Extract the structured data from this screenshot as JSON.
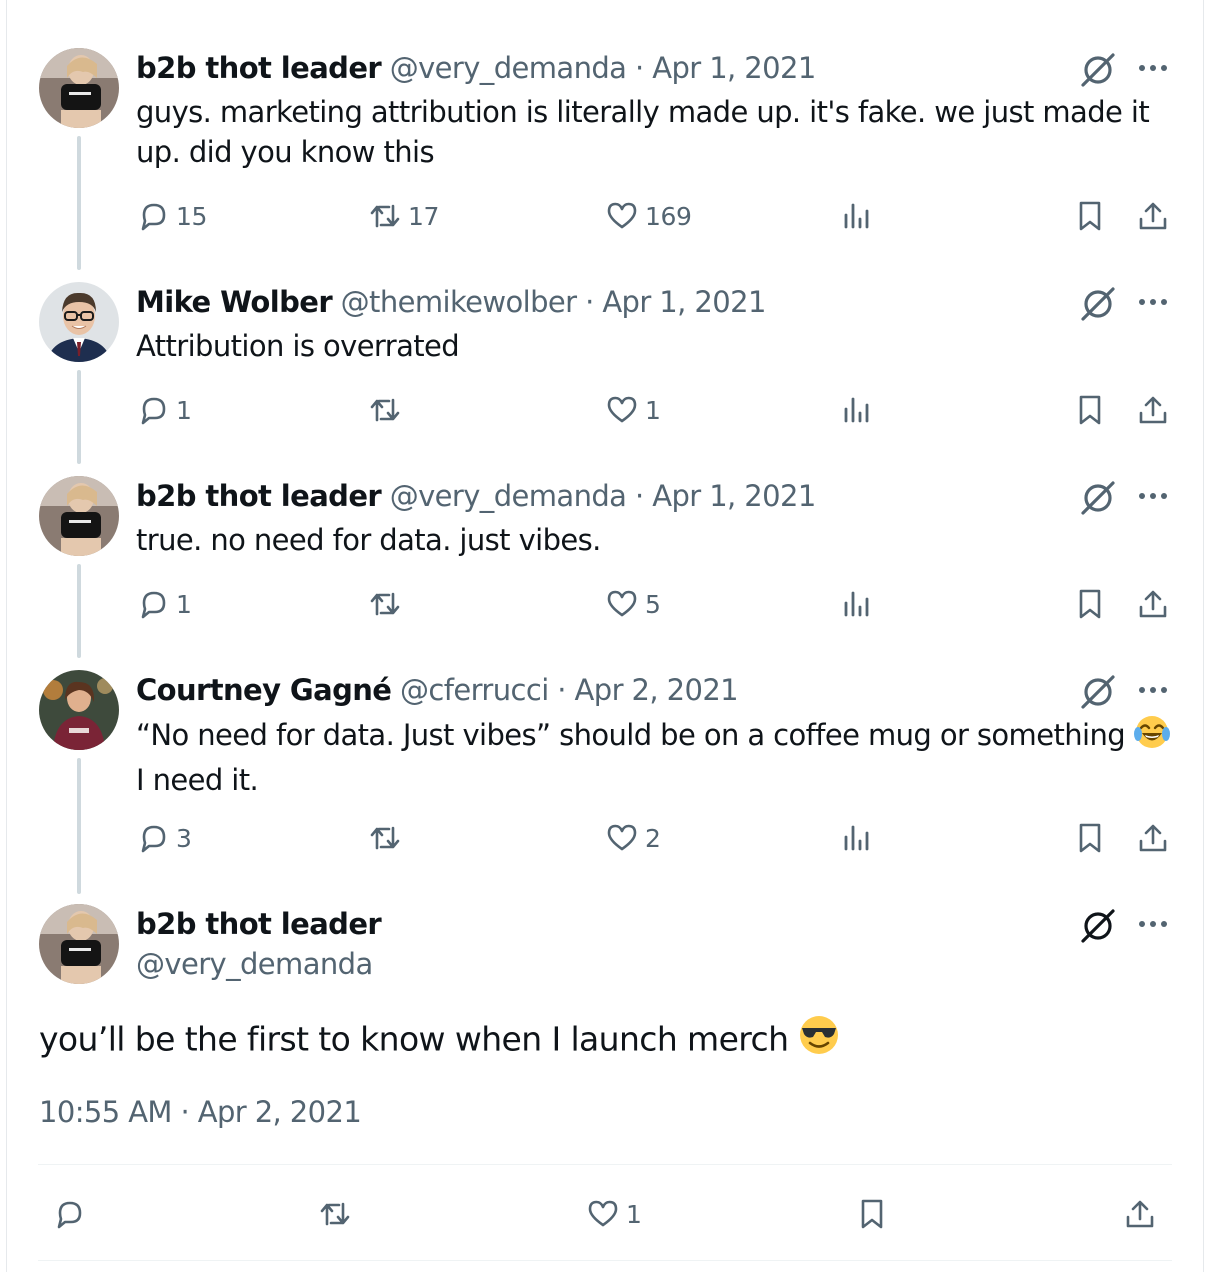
{
  "replies": [
    {
      "name": "b2b thot leader",
      "handle": "@very_demanda",
      "sep": " · ",
      "date": "Apr 1, 2021",
      "text": "guys. marketing attribution is literally made up. it's fake. we just made it up. did you know this",
      "replies": "15",
      "retweets": "17",
      "likes": "169"
    },
    {
      "name": "Mike Wolber",
      "handle": "@themikewolber",
      "sep": " · ",
      "date": "Apr 1, 2021",
      "text": "Attribution is overrated",
      "replies": "1",
      "retweets": "",
      "likes": "1"
    },
    {
      "name": "b2b thot leader",
      "handle": "@very_demanda",
      "sep": " · ",
      "date": "Apr 1, 2021",
      "text": "true. no need for data. just vibes.",
      "replies": "1",
      "retweets": "",
      "likes": "5"
    },
    {
      "name": "Courtney Gagné",
      "handle": "@cferrucci",
      "sep": " · ",
      "date": "Apr 2, 2021",
      "text_before": "“No need for data. Just vibes” should be on a coffee mug or something ",
      "text_after": " I need it.",
      "replies": "3",
      "retweets": "",
      "likes": "2"
    }
  ],
  "main": {
    "name": "b2b thot leader",
    "handle": "@very_demanda",
    "text": "you’ll be the first to know when I launch merch ",
    "time": "10:55 AM · Apr 2, 2021",
    "replies": "",
    "retweets": "",
    "likes": "1"
  },
  "icons": {
    "reply": "reply-icon",
    "retweet": "retweet-icon",
    "like": "heart-icon",
    "views": "views-icon",
    "bookmark": "bookmark-icon",
    "share": "share-icon",
    "grok": "grok-icon",
    "more": "more-icon",
    "emoji_laugh": "tears-of-joy-emoji",
    "emoji_cool": "sunglasses-emoji"
  },
  "colors": {
    "text": "#0f1419",
    "secondary": "#536471",
    "thread_line": "#cfd9de",
    "divider": "#eff3f4"
  }
}
